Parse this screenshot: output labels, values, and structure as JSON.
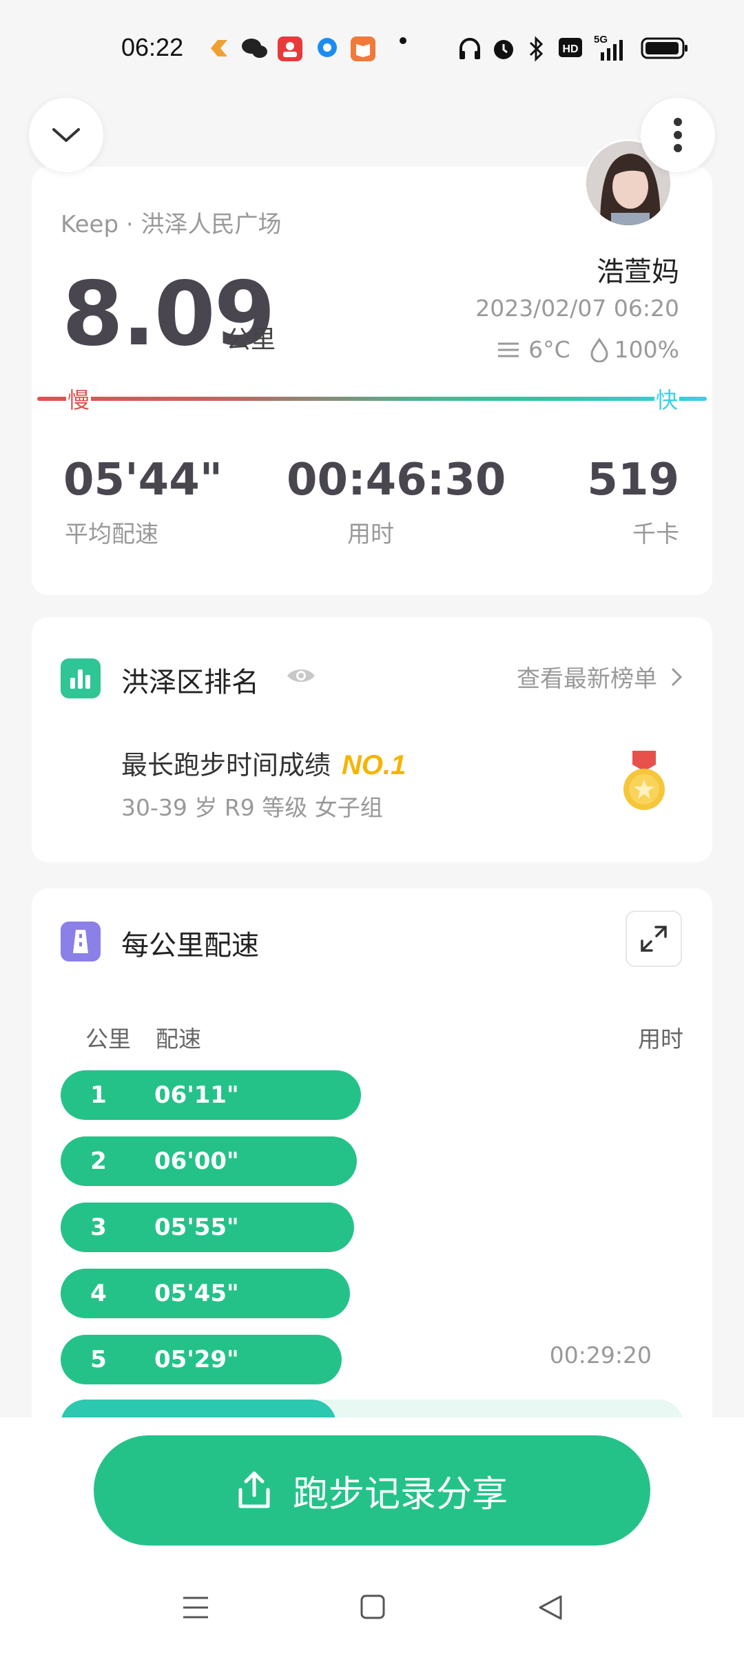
{
  "status_bar": {
    "time": "06:22",
    "network": "5G"
  },
  "summary": {
    "source": "Keep · 洪泽人民广场",
    "distance": "8.09",
    "distance_unit": "公里",
    "user_name": "浩萱妈",
    "datetime": "2023/02/07 06:20",
    "temperature": "6°C",
    "humidity": "100%",
    "slow_label": "慢",
    "fast_label": "快",
    "avg_pace": "05'44\"",
    "avg_pace_label": "平均配速",
    "duration": "00:46:30",
    "duration_label": "用时",
    "calories": "519",
    "calories_label": "千卡"
  },
  "ranking": {
    "title": "洪泽区排名",
    "link": "查看最新榜单",
    "achievement": "最长跑步时间成绩",
    "rank": "NO.1",
    "group": "30-39 岁 R9 等级 女子组"
  },
  "splits": {
    "title": "每公里配速",
    "header_km": "公里",
    "header_pace": "配速",
    "header_time": "用时",
    "rows": [
      {
        "km": "1",
        "pace": "06'11\"",
        "time": ""
      },
      {
        "km": "2",
        "pace": "06'00\"",
        "time": ""
      },
      {
        "km": "3",
        "pace": "05'55\"",
        "time": ""
      },
      {
        "km": "4",
        "pace": "05'45\"",
        "time": ""
      },
      {
        "km": "5",
        "pace": "05'29\"",
        "time": "00:29:20"
      }
    ]
  },
  "share_button": "跑步记录分享",
  "colors": {
    "accent": "#24c289",
    "slow": "#e0524f",
    "fast": "#3ad0e6",
    "gold": "#f5b400"
  }
}
